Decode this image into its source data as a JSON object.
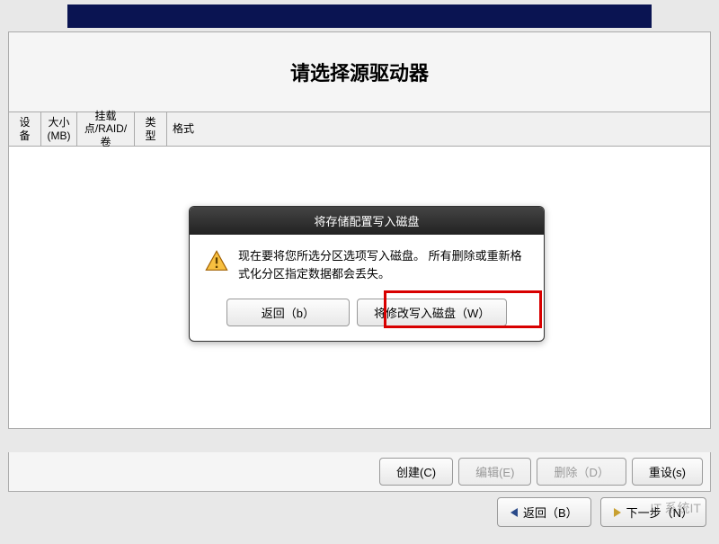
{
  "page_title": "请选择源驱动器",
  "table_headers": {
    "device": "设备",
    "size": "大小 (MB)",
    "mount": "挂载点/RAID/卷",
    "type": "类型",
    "format": "格式"
  },
  "dialog": {
    "title": "将存储配置写入磁盘",
    "message": "现在要将您所选分区选项写入磁盘。 所有删除或重新格式化分区指定数据都会丢失。",
    "back_btn": "返回（b）",
    "write_btn": "将修改写入磁盘（W）"
  },
  "action_buttons": {
    "create": "创建(C)",
    "edit": "编辑(E)",
    "delete": "删除（D）",
    "reset": "重设(s)"
  },
  "nav": {
    "back": "返回（B）",
    "next": "下一步（N）"
  },
  "watermark": "IT 系统IT"
}
